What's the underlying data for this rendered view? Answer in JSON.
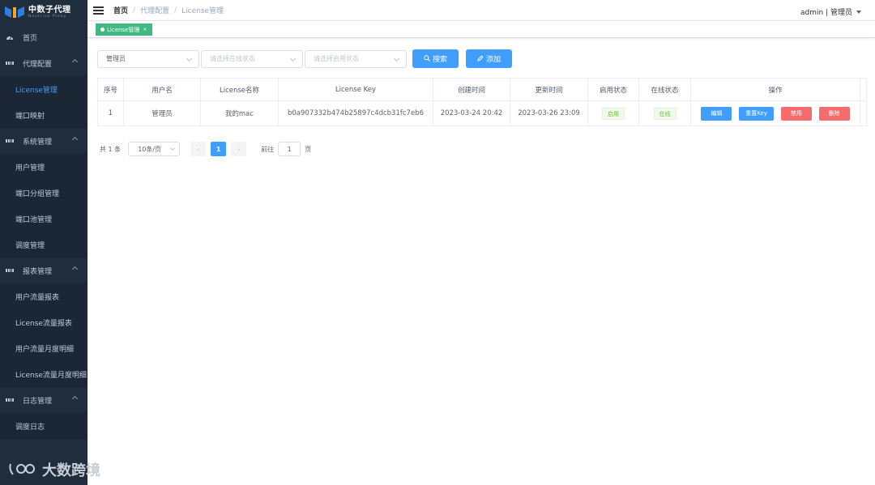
{
  "brand": {
    "title": "中数子代理",
    "subtitle": "Neutrino Proxy"
  },
  "sidebar": {
    "items": [
      {
        "label": "首页",
        "type": "top",
        "icon": "dashboard-icon"
      },
      {
        "label": "代理配置",
        "type": "group",
        "icon": "grid-icon"
      },
      {
        "label": "License管理",
        "type": "sub",
        "active": true
      },
      {
        "label": "端口映射",
        "type": "sub"
      },
      {
        "label": "系统管理",
        "type": "group",
        "icon": "grid-icon"
      },
      {
        "label": "用户管理",
        "type": "sub"
      },
      {
        "label": "端口分组管理",
        "type": "sub"
      },
      {
        "label": "端口池管理",
        "type": "sub"
      },
      {
        "label": "调度管理",
        "type": "sub"
      },
      {
        "label": "报表管理",
        "type": "group",
        "icon": "grid-icon"
      },
      {
        "label": "用户流量报表",
        "type": "sub"
      },
      {
        "label": "License流量报表",
        "type": "sub"
      },
      {
        "label": "用户流量月度明细",
        "type": "sub"
      },
      {
        "label": "License流量月度明细",
        "type": "sub"
      },
      {
        "label": "日志管理",
        "type": "group",
        "icon": "grid-icon"
      },
      {
        "label": "调度日志",
        "type": "sub"
      }
    ]
  },
  "header": {
    "breadcrumb": [
      "首页",
      "代理配置",
      "License管理"
    ],
    "user": "admin | 管理员"
  },
  "tags": {
    "active": "License管理",
    "close": "×"
  },
  "filters": {
    "user_value": "管理员",
    "online_placeholder": "请选择在线状态",
    "enable_placeholder": "请选择启用状态",
    "search_label": "搜索",
    "add_label": "添加"
  },
  "table": {
    "headers": [
      "序号",
      "用户名",
      "License名称",
      "License Key",
      "创建时间",
      "更新时间",
      "启用状态",
      "在线状态",
      "操作"
    ],
    "rows": [
      {
        "index": "1",
        "user": "管理员",
        "name": "我的mac",
        "key": "b0a907332b474b25897c4dcb31fc7eb6",
        "created": "2023-03-24 20:42",
        "updated": "2023-03-26 23:09",
        "enabled": "启用",
        "online": "在线",
        "actions": {
          "edit": "编辑",
          "reset": "重置Key",
          "disable": "禁用",
          "delete": "删除"
        }
      }
    ]
  },
  "pagination": {
    "total": "共 1 条",
    "page_size": "10条/页",
    "current": "1",
    "goto_label": "前往",
    "goto_value": "1",
    "page_suffix": "页"
  },
  "watermark": "大数跨境",
  "colors": {
    "primary": "#409eff",
    "danger": "#f56c6c",
    "tag_green": "#42b983",
    "sidebar_bg": "#1f2d3d"
  }
}
